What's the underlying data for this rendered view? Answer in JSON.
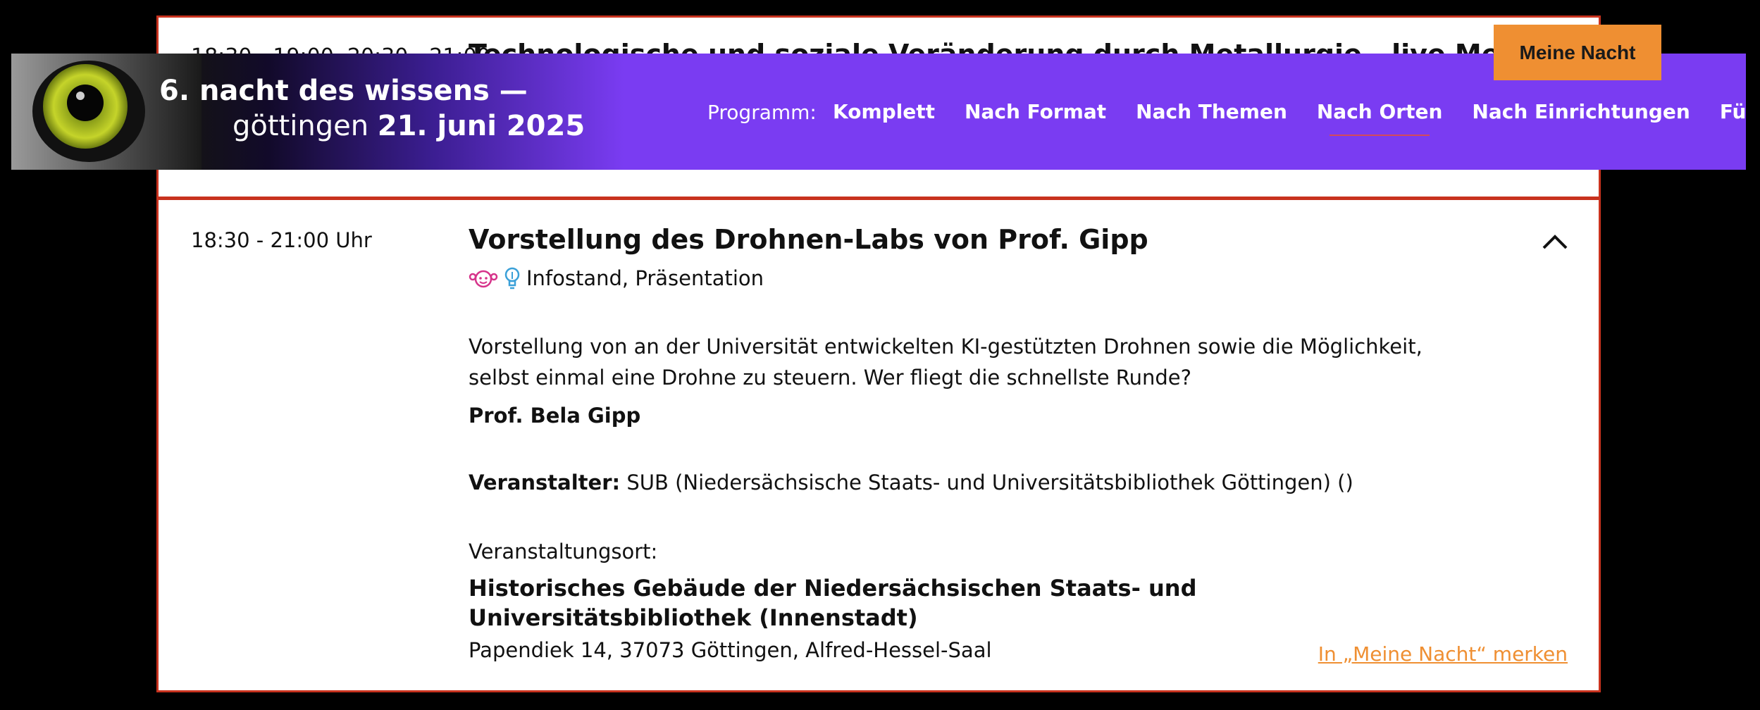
{
  "behind_card": {
    "time": "18:30 - 19:00, 20:30 - 21:00",
    "title": "Technologische und soziale Veränderung durch Metallurgie - live Metall"
  },
  "header": {
    "brand_line1": "6. nacht des wissens —",
    "brand_city": "göttingen",
    "brand_date": "21. juni 2025",
    "program_label": "Programm:",
    "nav": [
      {
        "label": "Komplett"
      },
      {
        "label": "Nach Format"
      },
      {
        "label": "Nach Themen"
      },
      {
        "label": "Nach Orten"
      },
      {
        "label": "Nach Einrichtungen"
      },
      {
        "label": "Für Kinder"
      }
    ],
    "meine_nacht": "Meine Nacht"
  },
  "event": {
    "time": "18:30 - 21:00 Uhr",
    "title": "Vorstellung des Drohnen-Labs von Prof. Gipp",
    "formats": "Infostand, Präsentation",
    "description": "Vorstellung von an der Universität entwickelten KI-gestützten Drohnen sowie die Möglichkeit, selbst einmal eine Drohne zu steuern. Wer fliegt die schnellste Runde?",
    "speaker": "Prof. Bela Gipp",
    "organizer_label": "Veranstalter:",
    "organizer_value": "SUB (Niedersächsische Staats- und Universitätsbibliothek Göttingen) ()",
    "venue_label": "Veranstaltungsort:",
    "venue_name": "Historisches Gebäude der Niedersächsischen Staats- und Universitätsbibliothek (Innenstadt)",
    "venue_address": "Papendiek 14, 37073 Göttingen, Alfred-Hessel-Saal",
    "bookmark": "In „Meine Nacht“ merken"
  },
  "colors": {
    "header_purple": "#7a3cf2",
    "accent_orange": "#ef8f32",
    "card_border": "#c8321e"
  }
}
